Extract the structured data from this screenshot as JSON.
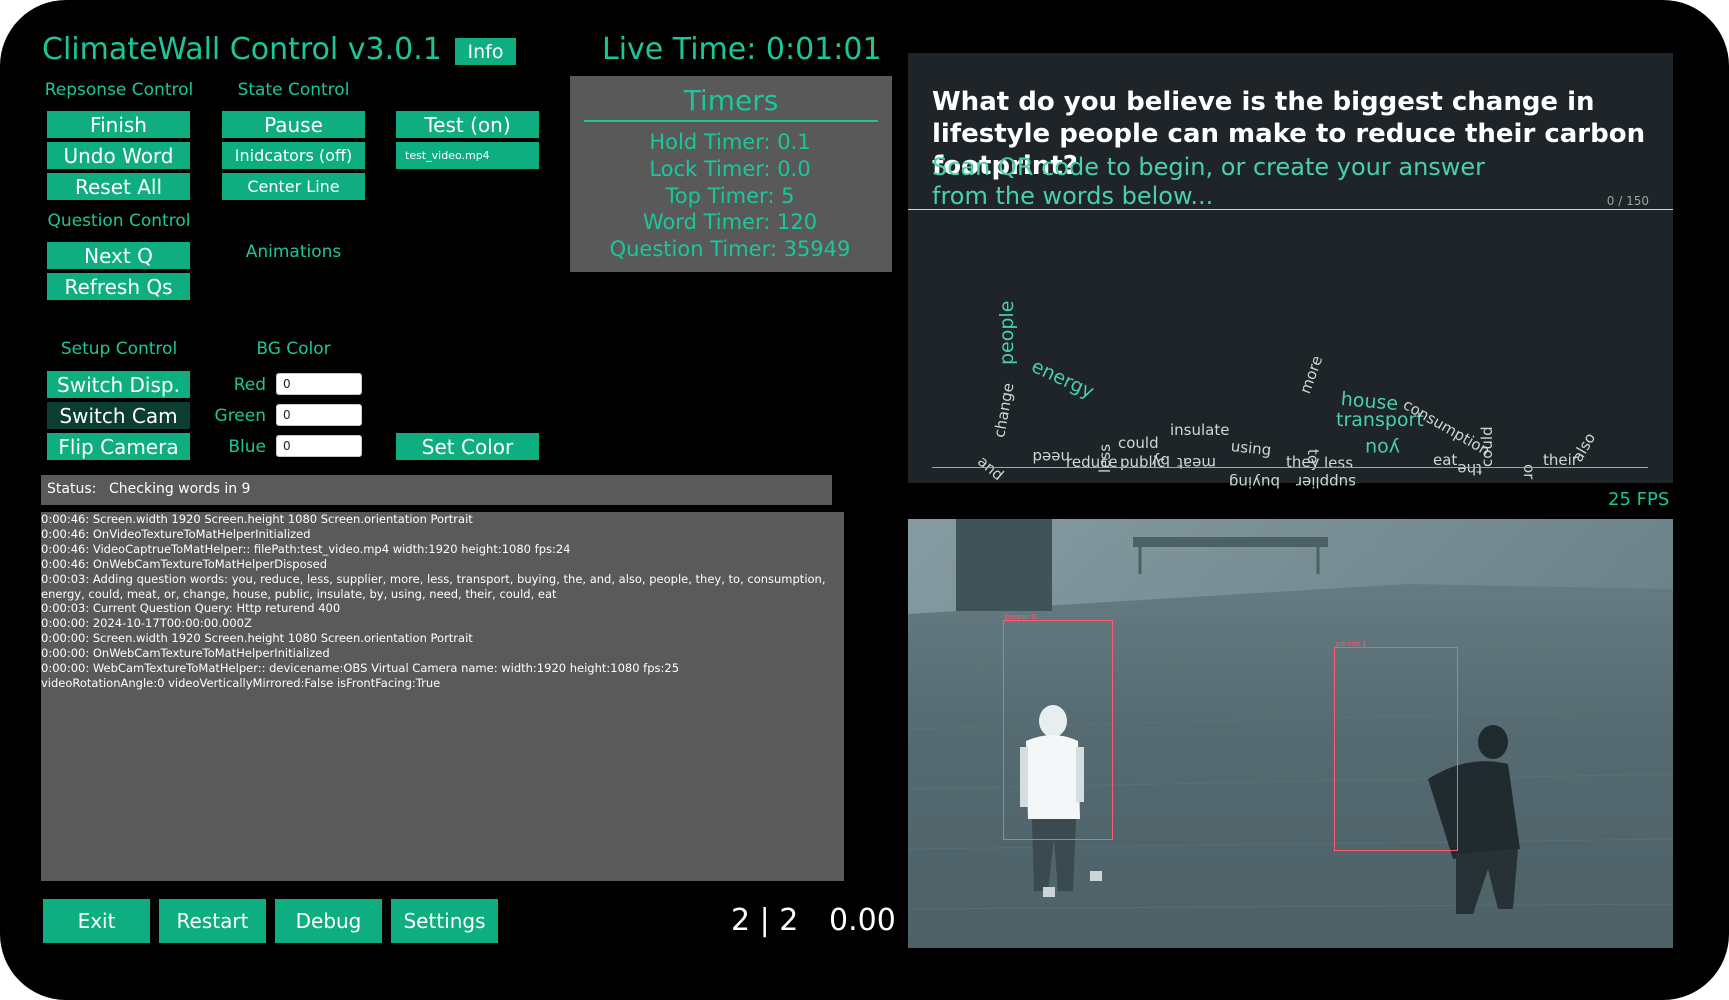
{
  "app": {
    "title": "ClimateWall Control v3.0.1",
    "info_label": "Info",
    "live_time_label": "Live Time:",
    "live_time_value": "0:01:01"
  },
  "response_control": {
    "heading": "Repsonse Control",
    "finish": "Finish",
    "undo_word": "Undo Word",
    "reset_all": "Reset All"
  },
  "question_control": {
    "heading": "Question Control",
    "next_q": "Next Q",
    "refresh_qs": "Refresh Qs"
  },
  "state_control": {
    "heading": "State Control",
    "pause": "Pause",
    "indicators": "Inidcators (off)",
    "center_line": "Center Line",
    "animations": "Animations"
  },
  "test": {
    "test_button": "Test (on)",
    "file_value": "test_video.mp4"
  },
  "setup_control": {
    "heading": "Setup Control",
    "switch_disp": "Switch Disp.",
    "switch_cam": "Switch Cam",
    "flip_camera": "Flip Camera"
  },
  "bg_color": {
    "heading": "BG Color",
    "red_label": "Red",
    "red_value": "0",
    "green_label": "Green",
    "green_value": "0",
    "blue_label": "Blue",
    "blue_value": "0",
    "set_color": "Set Color"
  },
  "timers": {
    "heading": "Timers",
    "hold": "Hold Timer:  0.1",
    "lock": "Lock Timer:  0.0",
    "top": "Top Timer:  5",
    "word": "Word Timer:  120",
    "question": "Question Timer:  35949"
  },
  "status": {
    "label": "Status:",
    "value": "Checking words in 9"
  },
  "log_lines": [
    "0:00:46: Screen.width 1920 Screen.height 1080 Screen.orientation Portrait",
    "0:00:46: OnVideoTextureToMatHelperInitialized",
    "0:00:46: VideoCaptrueToMatHelper:: filePath:test_video.mp4 width:1920 height:1080 fps:24",
    "0:00:46: OnWebCamTextureToMatHelperDisposed",
    "0:00:03: Adding question words: you, reduce, less, supplier, more, less, transport, buying, the, and, also, people, they, to, consumption,",
    "energy, could, meat, or, change, house, public, insulate, by, using, need, their, could, eat",
    "0:00:03: Current Question Query: Http returend 400",
    "0:00:00: 2024-10-17T00:00:00.000Z",
    "0:00:00: Screen.width 1920 Screen.height 1080 Screen.orientation Portrait",
    "0:00:00: OnWebCamTextureToMatHelperInitialized",
    "0:00:00: WebCamTextureToMatHelper:: devicename:OBS Virtual Camera name: width:1920 height:1080 fps:25",
    "videoRotationAngle:0 videoVerticallyMirrored:False isFrontFacing:True"
  ],
  "footer": {
    "exit": "Exit",
    "restart": "Restart",
    "debug": "Debug",
    "settings": "Settings",
    "counter": "2 | 2",
    "value": "0.00"
  },
  "question_display": {
    "question": "What do you believe is the biggest change in lifestyle people can make to reduce their carbon footprint?",
    "instruction_line1": "Scan QR code to begin, or create your answer",
    "instruction_line2": "from the words below...",
    "char_count": "0 / 150",
    "words": [
      "people",
      "energy",
      "change",
      "and",
      "need",
      "reduce",
      "less",
      "could",
      "by",
      "public",
      "insulate",
      "meat",
      "using",
      "buying",
      "supplier",
      "they",
      "to",
      "less",
      "more",
      "house",
      "transport",
      "consumption",
      "you",
      "eat",
      "the",
      "could",
      "or",
      "their",
      "also"
    ]
  },
  "video": {
    "fps": "25 FPS",
    "person0_label": "person 0",
    "person1_label": "person 1"
  },
  "colors": {
    "accent": "#1bc79a",
    "button": "#0fae80",
    "panel_gray": "#5a5a5a",
    "prompt_bg": "#1f2428",
    "bbox": "#ff5a6e"
  }
}
